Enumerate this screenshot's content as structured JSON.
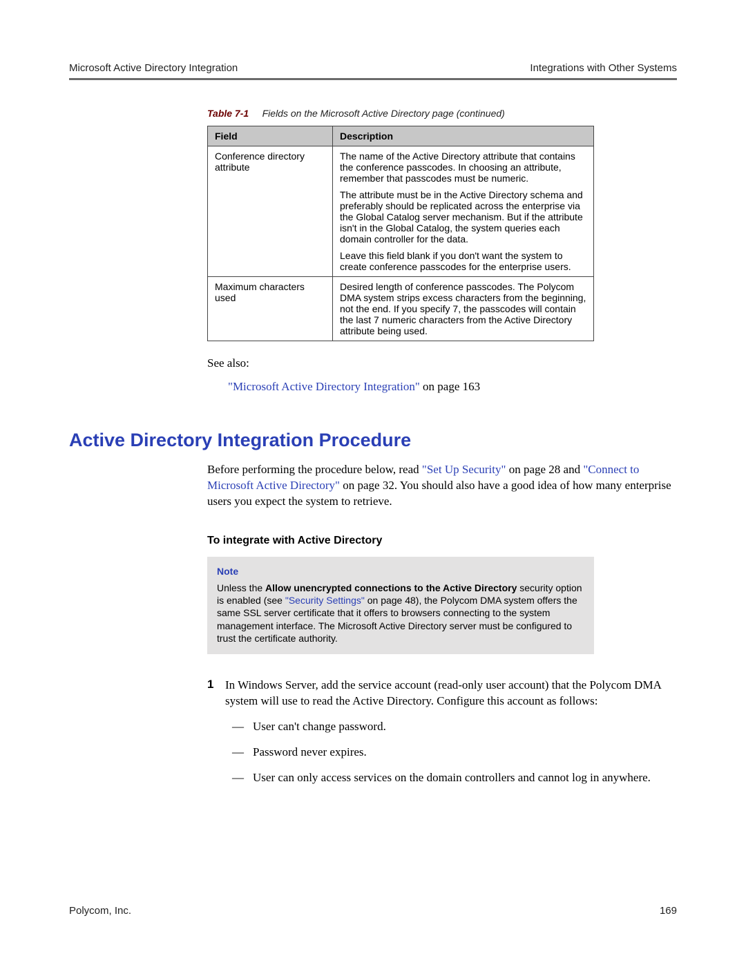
{
  "header": {
    "left": "Microsoft Active Directory Integration",
    "right": "Integrations with Other Systems"
  },
  "table": {
    "caption_label": "Table 7-1",
    "caption_text": "Fields on the Microsoft Active Directory page (continued)",
    "col_field": "Field",
    "col_desc": "Description",
    "row1": {
      "field": "Conference directory attribute",
      "p1": "The name of the Active Directory attribute that contains the conference passcodes. In choosing an attribute, remember that passcodes must be numeric.",
      "p2": "The attribute must be in the Active Directory schema and preferably should be replicated across the enterprise via the Global Catalog server mechanism. But if the attribute isn't in the Global Catalog, the system queries each domain controller for the data.",
      "p3": "Leave this field blank if you don't want the system to create conference passcodes for the enterprise users."
    },
    "row2": {
      "field": "Maximum characters used",
      "p1": "Desired length of conference passcodes. The Polycom DMA system strips excess characters from the beginning, not the end. If you specify 7, the passcodes will contain the last 7 numeric characters from the Active Directory attribute being used."
    }
  },
  "see_also": "See also:",
  "xref1_link": "\"Microsoft Active Directory Integration\"",
  "xref1_suffix": " on page 163",
  "h2": "Active Directory Integration Procedure",
  "intro": {
    "pre": "Before performing the procedure below, read ",
    "link1": "\"Set Up Security\"",
    "mid1": " on page 28 and ",
    "link2": "\"Connect to Microsoft Active Directory\"",
    "post": " on page 32. You should also have a good idea of how many enterprise users you expect the system to retrieve."
  },
  "h4": "To integrate with Active Directory",
  "note": {
    "title": "Note",
    "pre": "Unless the ",
    "bold": "Allow unencrypted connections to the Active Directory",
    "mid": " security option is enabled (see ",
    "link": "\"Security Settings\"",
    "post": " on page 48), the Polycom DMA system offers the same SSL server certificate that it offers to browsers connecting to the system management interface. The Microsoft Active Directory server must be configured to trust the certificate authority."
  },
  "step1": {
    "num": "1",
    "para": "In Windows Server, add the service account (read-only user account) that the Polycom DMA system will use to read the Active Directory. Configure this account as follows:",
    "b1": "User can't change password.",
    "b2": "Password never expires.",
    "b3": "User can only access services on the domain controllers and cannot log in anywhere."
  },
  "footer": {
    "left": "Polycom, Inc.",
    "right": "169"
  }
}
